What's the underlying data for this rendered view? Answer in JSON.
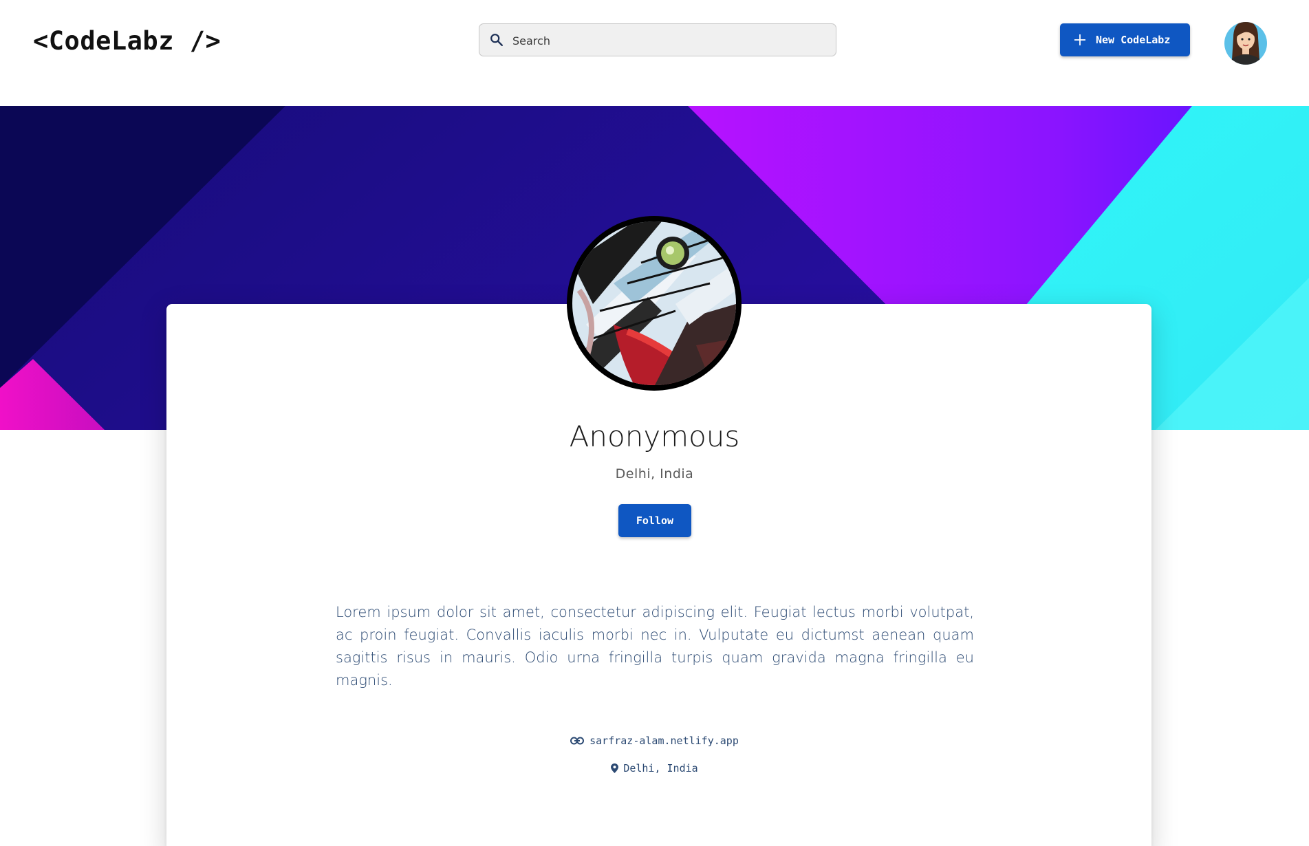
{
  "header": {
    "logo": "<CodeLabz />",
    "search_placeholder": "Search",
    "new_button_label": "New CodeLabz"
  },
  "profile": {
    "name": "Anonymous",
    "location": "Delhi, India",
    "follow_label": "Follow",
    "bio": "Lorem ipsum dolor sit amet, consectetur adipiscing elit. Feugiat lectus morbi volutpat, ac proin feugiat. Convallis iaculis morbi nec in. Vulputate eu dictumst aenean quam sagittis risus in mauris. Odio urna fringilla turpis quam gravida magna fringilla eu magnis.",
    "website": "sarfraz-alam.netlify.app",
    "meta_location": "Delhi, India"
  },
  "colors": {
    "primary": "#0f57c2",
    "bio_text": "#2c4a73",
    "banner_deep_navy": "#0b0755",
    "banner_indigo": "#1f0e9e",
    "banner_violet": "#a010ff",
    "banner_cyan": "#2ef5f7",
    "banner_magenta": "#e010c0"
  },
  "icons": [
    "search-icon",
    "plus-icon",
    "link-icon",
    "location-pin-icon"
  ]
}
